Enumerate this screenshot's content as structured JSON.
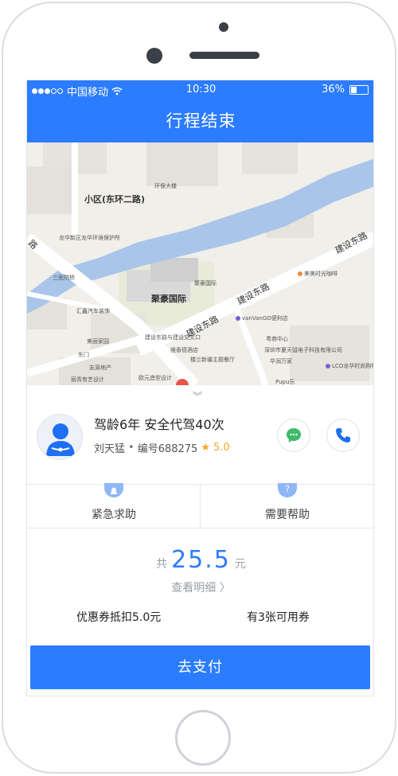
{
  "status_bar": {
    "carrier": "中国移动",
    "time": "10:30",
    "battery": "36%"
  },
  "nav": {
    "title": "行程结束"
  },
  "map": {
    "labels": {
      "community": "小区(东环二路)",
      "huanbao": "环保大楼",
      "longhua_env": "龙华新区龙华环境保护所",
      "sanyi": "三医院桥",
      "huiying": "汇鑫汽车装饰",
      "meili": "美丽家园",
      "dongmen": "东门",
      "youyuan": "友源地产",
      "lijing": "丽青有艺设计",
      "oumei": "欧元造型设计",
      "juhao_small": "聚豪国际",
      "juhao_big": "聚豪国际",
      "jianshe_jiaotong": "建设东路与建设交叉口",
      "weixiang": "维香德酒店",
      "lanxin": "楼兰新疆主题餐厅",
      "vanvango": "vanVanGO便利店",
      "yuhe": "粤商中心",
      "shenzhen_tianyu": "深圳市夏天钺电子科技有限公司",
      "huarun": "华润万家",
      "meiyu": "美美时光咖啡",
      "lco": "LCO龙华时尚购物物语",
      "pupu": "Pupu乐",
      "road1": "建设东路",
      "road2": "建设东路",
      "road3": "建设东路",
      "road4": "路"
    }
  },
  "driver": {
    "title": "驾龄6年 安全代驾40次",
    "name": "刘天猛",
    "id_text": "编号688275",
    "rating": "5.0"
  },
  "actions": {
    "emergency": "紧急求助",
    "help": "需要帮助",
    "help_icon": "?"
  },
  "fee": {
    "prefix": "共",
    "amount": "25.5",
    "unit": "元",
    "detail": "查看明细 〉",
    "coupon_deduct": "优惠券抵扣5.0元",
    "coupon_available": "有3张可用券"
  },
  "pay": {
    "label": "去支付"
  },
  "colors": {
    "primary": "#2b7cff",
    "rating": "#f5a623",
    "river": "#a9c5ea"
  },
  "icons": [
    "wifi-icon",
    "battery-icon",
    "chevron-down-icon",
    "avatar-icon",
    "chat-icon",
    "phone-icon",
    "alarm-icon",
    "question-icon"
  ]
}
